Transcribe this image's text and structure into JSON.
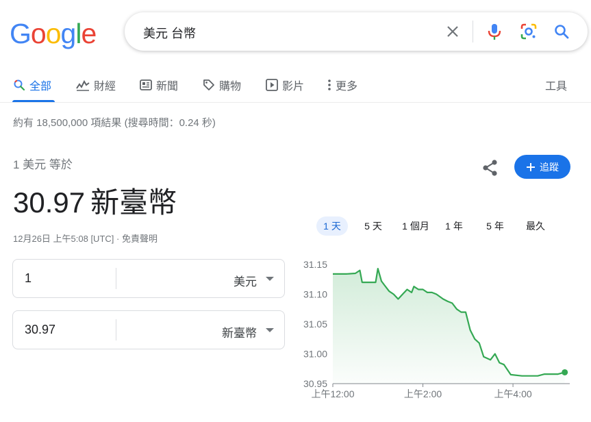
{
  "logo": {
    "letters": [
      "G",
      "o",
      "o",
      "g",
      "l",
      "e"
    ],
    "colors": [
      "#4285F4",
      "#EA4335",
      "#FBBC05",
      "#4285F4",
      "#34A853",
      "#EA4335"
    ]
  },
  "search": {
    "query": "美元 台幣"
  },
  "tabs": [
    {
      "label": "全部",
      "icon": "search-icon",
      "active": true
    },
    {
      "label": "財經",
      "icon": "finance-chart-icon"
    },
    {
      "label": "新聞",
      "icon": "news-icon"
    },
    {
      "label": "購物",
      "icon": "tag-icon"
    },
    {
      "label": "影片",
      "icon": "play-icon"
    },
    {
      "label": "更多",
      "icon": "more-vert-icon"
    }
  ],
  "tools_label": "工具",
  "result_stats": "約有 18,500,000 項結果 (搜尋時間：0.24 秒)",
  "converter": {
    "label": "1 美元 等於",
    "value": "30.97",
    "unit": "新臺幣",
    "date": "12月26日 上午5:08 [UTC] · 免責聲明",
    "follow_label": "追蹤",
    "from": {
      "amount": "1",
      "currency": "美元"
    },
    "to": {
      "amount": "30.97",
      "currency": "新臺幣"
    }
  },
  "ranges": [
    "1 天",
    "5 天",
    "1 個月",
    "1 年",
    "5 年",
    "最久"
  ],
  "active_range": "1 天",
  "colors": {
    "accent": "#1a73e8",
    "line": "#34a853"
  },
  "chart_data": {
    "type": "area",
    "ylim": [
      30.95,
      31.15
    ],
    "yticks": [
      "31.15",
      "31.10",
      "31.05",
      "31.00",
      "30.95"
    ],
    "xticks": [
      {
        "label": "上午12:00",
        "x": 0
      },
      {
        "label": "上午2:00",
        "x": 2
      },
      {
        "label": "上午4:00",
        "x": 4
      }
    ],
    "xlim": [
      0,
      5.2
    ],
    "series": [
      {
        "x": [
          0,
          0.3,
          0.5,
          0.6,
          0.65,
          0.75,
          0.95,
          1.0,
          1.08,
          1.15,
          1.25,
          1.35,
          1.45,
          1.55,
          1.65,
          1.75,
          1.8,
          1.9,
          2.0,
          2.1,
          2.2,
          2.3,
          2.45,
          2.55,
          2.65,
          2.75,
          2.85,
          2.95,
          3.05,
          3.15,
          3.25,
          3.35,
          3.5,
          3.6,
          3.7,
          3.8,
          3.95,
          4.2,
          4.4,
          4.55,
          4.7,
          4.85,
          5.0,
          5.1,
          5.15
        ],
        "values": [
          31.134,
          31.134,
          31.135,
          31.14,
          31.12,
          31.12,
          31.12,
          31.143,
          31.122,
          31.115,
          31.105,
          31.1,
          31.092,
          31.1,
          31.108,
          31.103,
          31.113,
          31.108,
          31.108,
          31.103,
          31.103,
          31.1,
          31.092,
          31.088,
          31.085,
          31.075,
          31.07,
          31.07,
          31.04,
          31.025,
          31.018,
          30.995,
          30.99,
          31.0,
          30.985,
          30.982,
          30.965,
          30.963,
          30.963,
          30.963,
          30.966,
          30.966,
          30.966,
          30.968,
          30.969
        ]
      }
    ]
  }
}
